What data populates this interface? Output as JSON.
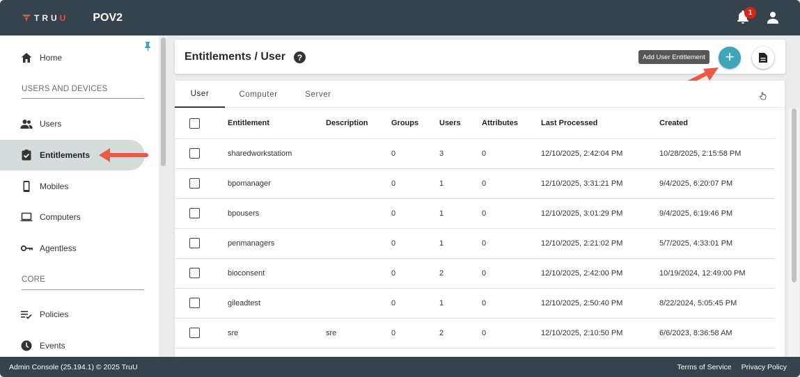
{
  "header": {
    "logo_text_1": "TRU",
    "logo_text_2": "U",
    "app_title": "POV2",
    "notification_count": "1"
  },
  "sidebar": {
    "items": [
      {
        "label": "Home"
      },
      {
        "label": "Users"
      },
      {
        "label": "Entitlements"
      },
      {
        "label": "Mobiles"
      },
      {
        "label": "Computers"
      },
      {
        "label": "Agentless"
      },
      {
        "label": "Policies"
      },
      {
        "label": "Events"
      }
    ],
    "sections": {
      "users_devices": "USERS AND DEVICES",
      "core": "CORE"
    },
    "active": "Entitlements"
  },
  "page": {
    "title": "Entitlements / User",
    "help": "?",
    "tooltip": "Add User Entitlement",
    "add_label": "+"
  },
  "tabs": [
    {
      "label": "User",
      "active": true
    },
    {
      "label": "Computer",
      "active": false
    },
    {
      "label": "Server",
      "active": false
    }
  ],
  "table": {
    "columns": [
      "Entitlement",
      "Description",
      "Groups",
      "Users",
      "Attributes",
      "Last Processed",
      "Created"
    ],
    "rows": [
      {
        "entitlement": "sharedworkstatiom",
        "description": "",
        "groups": "0",
        "users": "3",
        "attributes": "0",
        "last_processed": "12/10/2025, 2:42:04 PM",
        "created": "10/28/2025, 2:15:58 PM"
      },
      {
        "entitlement": "bpomanager",
        "description": "",
        "groups": "0",
        "users": "1",
        "attributes": "0",
        "last_processed": "12/10/2025, 3:31:21 PM",
        "created": "9/4/2025, 6:20:07 PM"
      },
      {
        "entitlement": "bpousers",
        "description": "",
        "groups": "0",
        "users": "1",
        "attributes": "0",
        "last_processed": "12/10/2025, 3:01:29 PM",
        "created": "9/4/2025, 6:19:46 PM"
      },
      {
        "entitlement": "penmanagers",
        "description": "",
        "groups": "0",
        "users": "1",
        "attributes": "0",
        "last_processed": "12/10/2025, 2:21:02 PM",
        "created": "5/7/2025, 4:33:01 PM"
      },
      {
        "entitlement": "bioconsent",
        "description": "",
        "groups": "0",
        "users": "2",
        "attributes": "0",
        "last_processed": "12/10/2025, 2:42:00 PM",
        "created": "10/19/2024, 12:49:00 PM"
      },
      {
        "entitlement": "gileadtest",
        "description": "",
        "groups": "0",
        "users": "1",
        "attributes": "0",
        "last_processed": "12/10/2025, 2:50:40 PM",
        "created": "8/22/2024, 5:05:45 PM"
      },
      {
        "entitlement": "sre",
        "description": "sre",
        "groups": "0",
        "users": "2",
        "attributes": "0",
        "last_processed": "12/10/2025, 2:10:50 PM",
        "created": "6/6/2023, 8:36:58 AM"
      }
    ]
  },
  "footer": {
    "left": "Admin Console (25.194.1) © 2025 TruU",
    "terms": "Terms of Service",
    "privacy": "Privacy Policy"
  },
  "colors": {
    "topbar": "#36424c",
    "accent": "#3fa5b8",
    "annotation_arrow": "#ea5a47",
    "badge": "#d8261c",
    "active_nav": "#d5dcdc"
  }
}
